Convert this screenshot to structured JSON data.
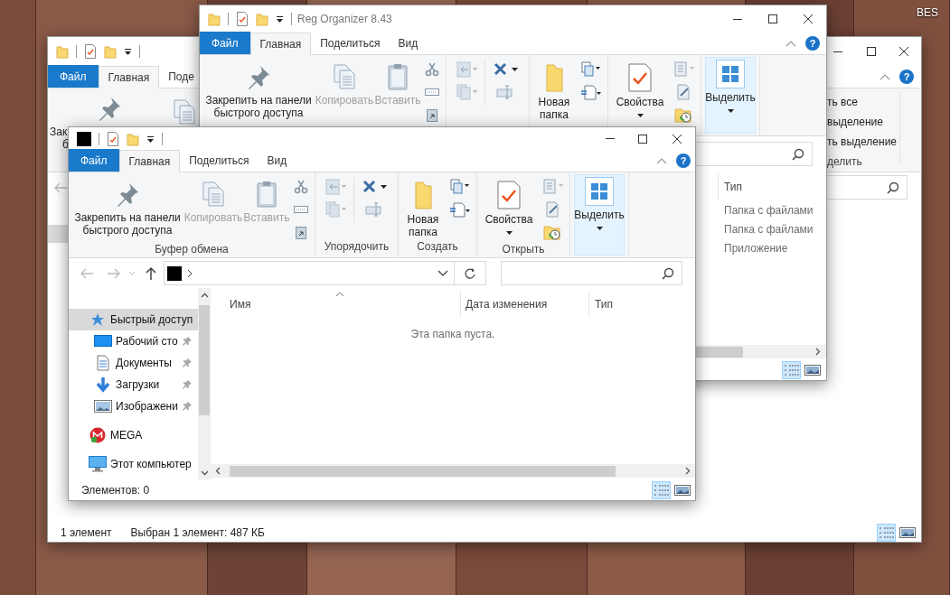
{
  "desktop": {
    "icon_label": "BES"
  },
  "back_window": {
    "tabs": [
      {
        "label": "Файл",
        "kind": "file",
        "selected": false
      },
      {
        "label": "Главная",
        "kind": "tab",
        "selected": true
      },
      {
        "label": "Поде",
        "kind": "tab",
        "selected": false
      }
    ],
    "help": "?",
    "ribbon": {
      "pin_label_lines": [
        "Зак",
        "б"
      ],
      "select_items": [
        "ть все",
        "выделение",
        "ть выделение"
      ],
      "select_group_label": "делить"
    },
    "status_bar": {
      "item_count": "1 элемент",
      "selection": "Выбран 1 элемент: 487 КБ"
    },
    "views": [
      {
        "kind": "details",
        "selected": true
      },
      {
        "kind": "tiles",
        "selected": false
      }
    ]
  },
  "middle_window": {
    "title": "Reg Organizer 8.43",
    "tabs": [
      {
        "label": "Файл",
        "kind": "file",
        "selected": false
      },
      {
        "label": "Главная",
        "kind": "tab",
        "selected": true
      },
      {
        "label": "Поделиться",
        "kind": "tab",
        "selected": false
      },
      {
        "label": "Вид",
        "kind": "tab",
        "selected": false
      }
    ],
    "help": "?",
    "ribbon": {
      "groups": [
        {
          "kind": "clipboard",
          "buttons": [
            {
              "kind": "pin",
              "label": "Закрепить на панели быстрого доступа",
              "disabled": false
            },
            {
              "kind": "copy",
              "label": "Копировать",
              "disabled": true
            },
            {
              "kind": "paste",
              "label": "Вставить",
              "disabled": true
            }
          ]
        },
        {
          "kind": "organize"
        },
        {
          "kind": "new",
          "buttons": [
            {
              "kind": "new-folder",
              "label": "Новая папка",
              "disabled": false
            }
          ]
        },
        {
          "kind": "open",
          "buttons": [
            {
              "kind": "properties",
              "label": "Свойства",
              "disabled": false,
              "dropdown": true
            }
          ]
        },
        {
          "kind": "select",
          "buttons": [
            {
              "kind": "select",
              "label": "Выделить",
              "disabled": false,
              "dropdown": true,
              "hovered": true
            }
          ]
        }
      ]
    },
    "columns": [
      {
        "label": "Тип"
      }
    ],
    "rows": [
      {
        "type": "Папка с файлами"
      },
      {
        "type": "Папка с файлами"
      },
      {
        "type": "Приложение"
      }
    ],
    "views": [
      {
        "kind": "details",
        "selected": true
      },
      {
        "kind": "tiles",
        "selected": false
      }
    ]
  },
  "front_window": {
    "tabs": [
      {
        "label": "Файл",
        "kind": "file",
        "selected": false
      },
      {
        "label": "Главная",
        "kind": "tab",
        "selected": true
      },
      {
        "label": "Поделиться",
        "kind": "tab",
        "selected": false
      },
      {
        "label": "Вид",
        "kind": "tab",
        "selected": false
      }
    ],
    "help": "?",
    "ribbon": {
      "groups": [
        {
          "kind": "clipboard",
          "label": "Буфер обмена",
          "buttons": [
            {
              "kind": "pin",
              "label": "Закрепить на панели быстрого доступа",
              "disabled": false
            },
            {
              "kind": "copy",
              "label": "Копировать",
              "disabled": true
            },
            {
              "kind": "paste",
              "label": "Вставить",
              "disabled": true
            }
          ]
        },
        {
          "kind": "organize",
          "label": "Упорядочить"
        },
        {
          "kind": "new",
          "label": "Создать",
          "buttons": [
            {
              "kind": "new-folder",
              "label": "Новая папка",
              "disabled": false
            }
          ]
        },
        {
          "kind": "open",
          "label": "Открыть",
          "buttons": [
            {
              "kind": "properties",
              "label": "Свойства",
              "disabled": false,
              "dropdown": true
            }
          ]
        },
        {
          "kind": "select",
          "buttons": [
            {
              "kind": "select",
              "label": "Выделить",
              "disabled": false,
              "dropdown": true,
              "hovered": true
            }
          ]
        }
      ]
    },
    "columns": [
      {
        "label": "Имя",
        "sorted": true
      },
      {
        "label": "Дата изменения",
        "sorted": false
      },
      {
        "label": "Тип",
        "sorted": false
      }
    ],
    "empty_message": "Эта папка пуста.",
    "nav_items": [
      {
        "label": "Быстрый доступ",
        "kind": "quick-access",
        "selected": true,
        "pinned": false,
        "children": [
          {
            "label": "Рабочий сто",
            "kind": "desktop",
            "selected": false,
            "pinned": true
          },
          {
            "label": "Документы",
            "kind": "documents",
            "selected": false,
            "pinned": true
          },
          {
            "label": "Загрузки",
            "kind": "downloads",
            "selected": false,
            "pinned": true
          },
          {
            "label": "Изображени",
            "kind": "pictures",
            "selected": false,
            "pinned": true
          }
        ]
      },
      {
        "label": "MEGA",
        "kind": "mega",
        "selected": false,
        "pinned": false
      },
      {
        "label": "Этот компьютер",
        "kind": "computer",
        "selected": false,
        "pinned": false
      }
    ],
    "status_bar": {
      "item_count": "Элементов: 0"
    },
    "views": [
      {
        "kind": "details",
        "selected": true
      },
      {
        "kind": "tiles",
        "selected": false
      }
    ]
  }
}
